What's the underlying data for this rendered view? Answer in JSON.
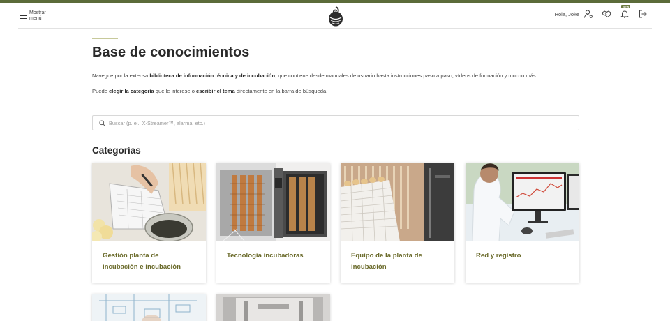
{
  "header": {
    "menu_label": "Mostrar menú",
    "greeting": "Hola, Joke",
    "new_badge": "NEW"
  },
  "page": {
    "title": "Base de conocimientos",
    "intro_pre": "Navegue por la extensa ",
    "intro_bold": "biblioteca de información técnica y de incubación",
    "intro_post": ", que contiene desde manuales de usuario hasta instrucciones paso a paso, vídeos de formación y mucho más.",
    "intro2_pre": "Puede ",
    "intro2_bold1": "elegir la categoría",
    "intro2_mid": " que le interese o ",
    "intro2_bold2": "escribir el tema",
    "intro2_post": " directamente en la barra de búsqueda."
  },
  "search": {
    "placeholder": "Buscar (p. ej., X-Streamer™, alarma, etc.)"
  },
  "categories": {
    "title": "Categorías",
    "items": [
      {
        "label": "Gestión planta de incubación e incubación"
      },
      {
        "label": "Tecnología incubadoras"
      },
      {
        "label": "Equipo de la planta de incubación"
      },
      {
        "label": "Red y registro"
      }
    ]
  },
  "colors": {
    "accent": "#5b6b39",
    "card_label": "#6a6a2a"
  }
}
